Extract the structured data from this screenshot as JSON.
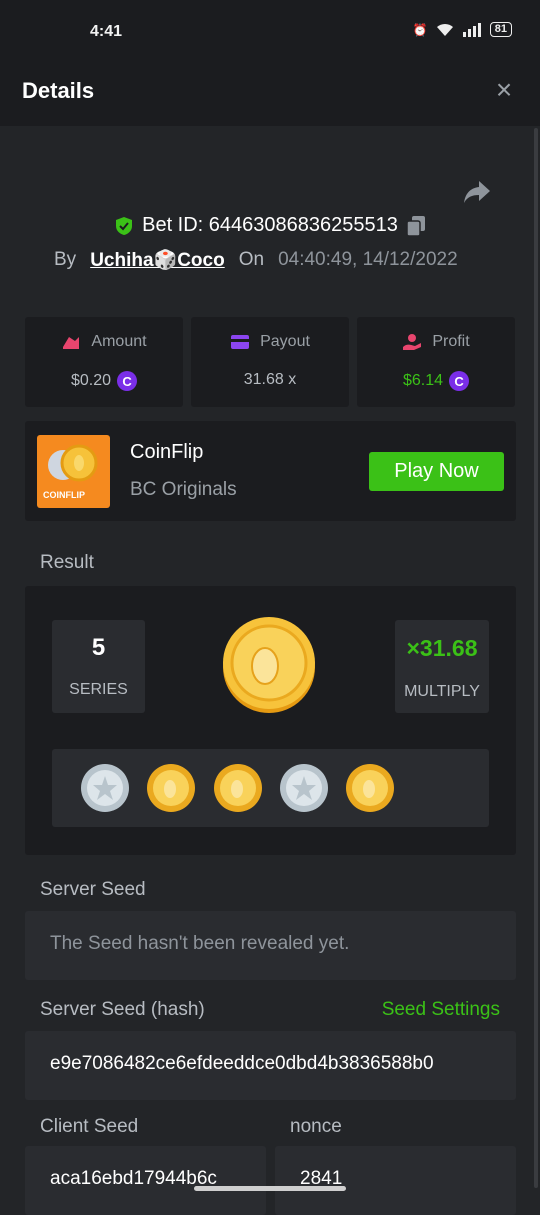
{
  "status_bar": {
    "time": "4:41",
    "battery": "81"
  },
  "header": {
    "title": "Details",
    "close_icon": "×"
  },
  "bet": {
    "id_label": "Bet ID: 64463086836255513",
    "by_label": "By",
    "username": "Uchiha🎲Coco",
    "on_label": "On",
    "datetime": "04:40:49, 14/12/2022"
  },
  "stats": {
    "amount_label": "Amount",
    "amount_value": "$0.20",
    "payout_label": "Payout",
    "payout_value": "31.68 x",
    "profit_label": "Profit",
    "profit_value": "$6.14",
    "coin_symbol": "C"
  },
  "game": {
    "name": "CoinFlip",
    "provider": "BC Originals",
    "thumb_label": "COINFLIP",
    "play_label": "Play Now"
  },
  "result": {
    "section_label": "Result",
    "series_value": "5",
    "series_label": "SERIES",
    "multiplier_value": "×31.68",
    "multiplier_label": "MULTIPLY",
    "flips": [
      "silver",
      "gold",
      "gold",
      "silver",
      "gold"
    ]
  },
  "server_seed": {
    "label": "Server Seed",
    "value": "The Seed hasn't been revealed yet."
  },
  "server_seed_hash": {
    "label": "Server Seed (hash)",
    "settings_label": "Seed Settings",
    "value": "e9e7086482ce6efdeeddce0dbd4b3836588b0"
  },
  "client_seed": {
    "label": "Client Seed",
    "value": "aca16ebd17944b6c"
  },
  "nonce": {
    "label": "nonce",
    "value": "2841"
  },
  "colors": {
    "accent_green": "#3bc117",
    "bc_purple": "#7a2ee8",
    "bg": "#232528",
    "panel": "#1b1c1f"
  }
}
